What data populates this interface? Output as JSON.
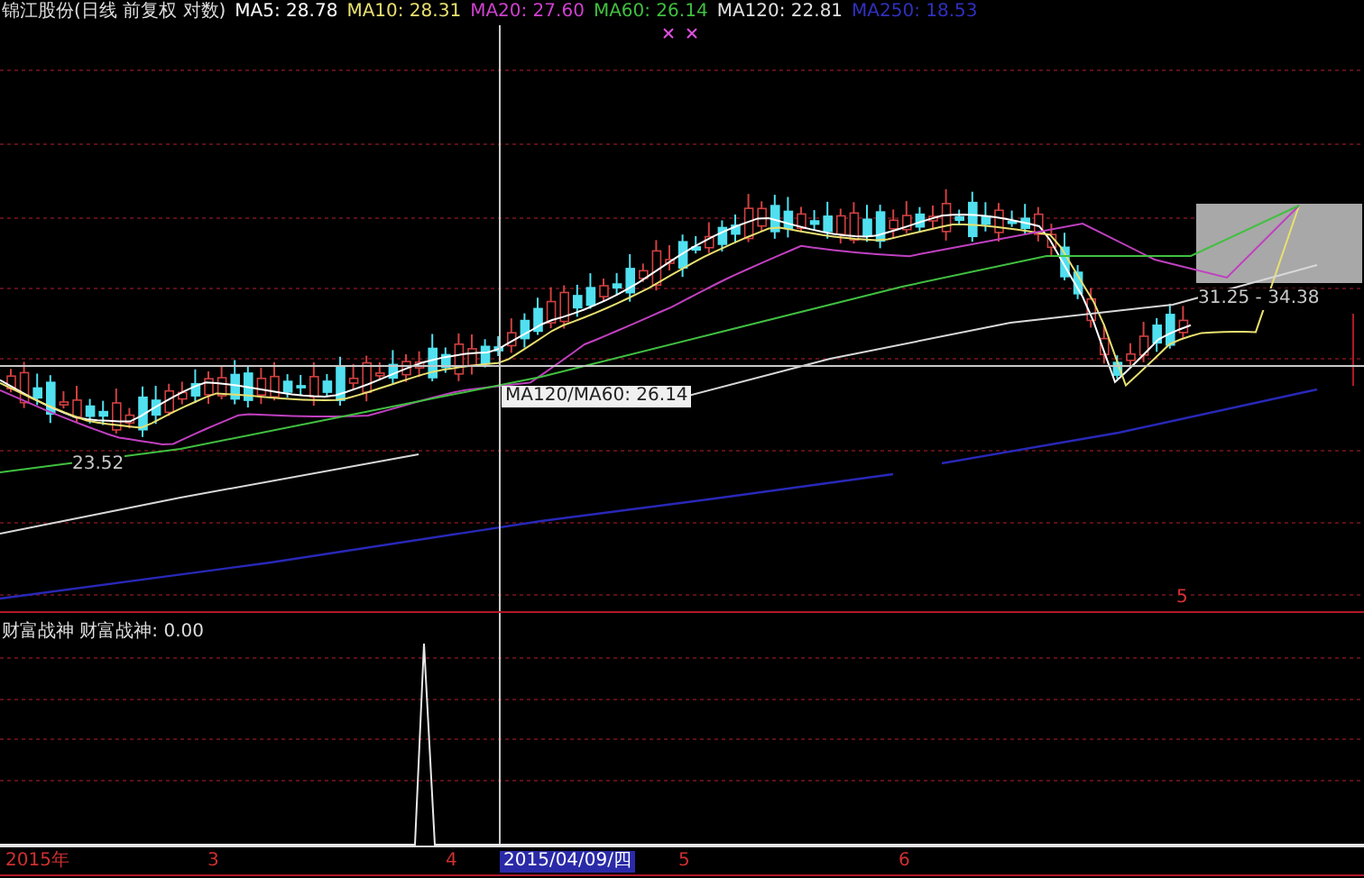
{
  "header": {
    "title": "锦江股份(日线 前复权 对数)",
    "indicators": [
      {
        "label": "MA5: 28.78",
        "color": "#ffffff"
      },
      {
        "label": "MA10: 28.31",
        "color": "#e8e070"
      },
      {
        "label": "MA20: 27.60",
        "color": "#d040d0"
      },
      {
        "label": "MA60: 26.14",
        "color": "#40c040"
      },
      {
        "label": "MA120: 22.81",
        "color": "#e0e0e0"
      },
      {
        "label": "MA250: 18.53",
        "color": "#3030c0"
      }
    ]
  },
  "price_chart": {
    "labels": [
      {
        "kind": "low",
        "text": "23.52"
      },
      {
        "kind": "range",
        "text": "31.25 - 34.38"
      },
      {
        "kind": "crosshair",
        "text": "MA120/MA60: 26.14"
      },
      {
        "kind": "marker",
        "text": "5"
      }
    ]
  },
  "indicator_panel": {
    "title": "财富战神 财富战神: 0.00"
  },
  "time_axis": {
    "labels": [
      {
        "text": "2015年",
        "selected": false
      },
      {
        "text": "3",
        "selected": false
      },
      {
        "text": "4",
        "selected": false
      },
      {
        "text": "2015/04/09/四",
        "selected": true
      },
      {
        "text": "5",
        "selected": false
      },
      {
        "text": "6",
        "selected": false
      }
    ]
  }
}
